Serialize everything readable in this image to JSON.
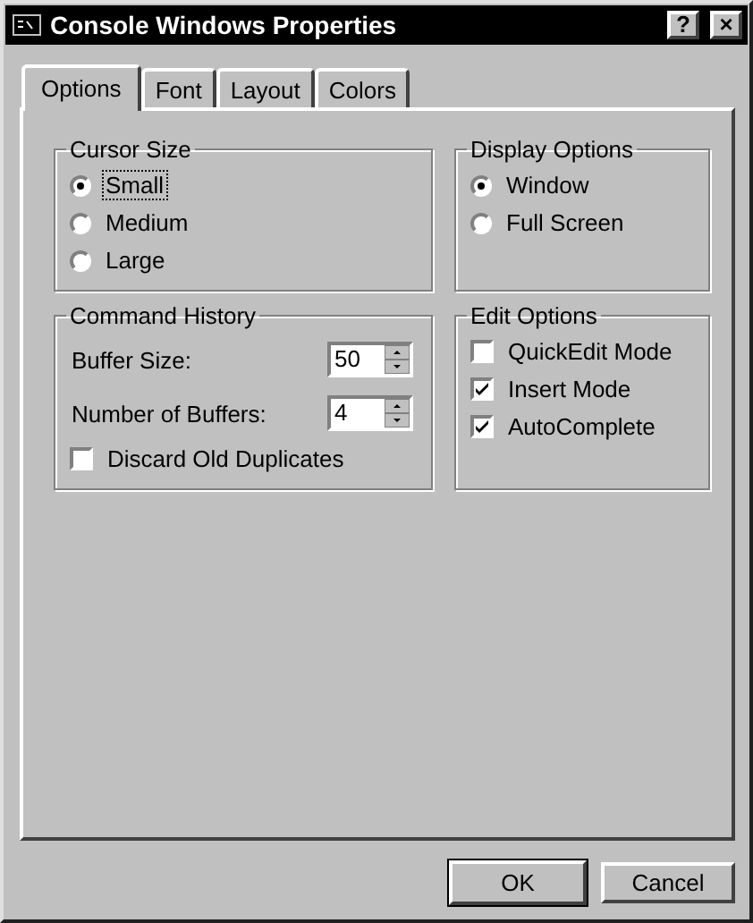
{
  "window": {
    "title": "Console Windows Properties",
    "buttons": [
      "?",
      "×"
    ]
  },
  "tabs": [
    {
      "label": "Options",
      "selected": true
    },
    {
      "label": "Font",
      "selected": false
    },
    {
      "label": "Layout",
      "selected": false
    },
    {
      "label": "Colors",
      "selected": false
    }
  ],
  "cursor_size": {
    "title": "Cursor Size",
    "options": [
      {
        "label": "Small",
        "selected": true
      },
      {
        "label": "Medium",
        "selected": false
      },
      {
        "label": "Large",
        "selected": false
      }
    ]
  },
  "command_history": {
    "title": "Command History",
    "spinners": [
      {
        "label": "Buffer Size:",
        "value": "50"
      },
      {
        "label": "Number of Buffers:",
        "value": "4"
      }
    ],
    "checkbox": {
      "label": "Discard Old Duplicates",
      "checked": false
    }
  },
  "display_options": {
    "title": "Display Options",
    "options": [
      {
        "label": "Window",
        "selected": true
      },
      {
        "label": "Full Screen",
        "selected": false
      }
    ]
  },
  "edit_options": {
    "title": "Edit Options",
    "checkboxes": [
      {
        "label": "QuickEdit Mode",
        "checked": false
      },
      {
        "label": "Insert Mode",
        "checked": true
      },
      {
        "label": "AutoComplete",
        "checked": true
      }
    ]
  },
  "buttons": [
    "OK",
    "Cancel"
  ]
}
